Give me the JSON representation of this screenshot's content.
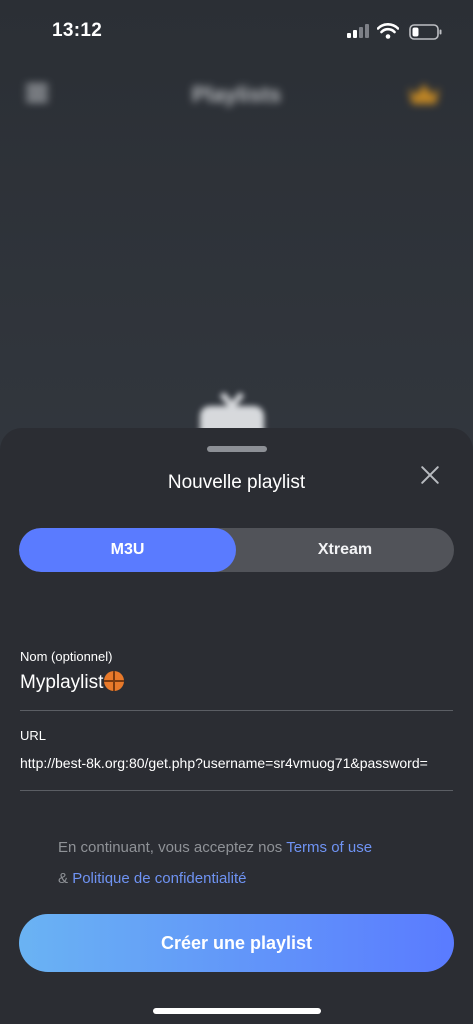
{
  "status_bar": {
    "time": "13:12"
  },
  "background": {
    "title": "Playlists"
  },
  "sheet": {
    "title": "Nouvelle playlist",
    "tabs": [
      {
        "label": "M3U",
        "selected": true
      },
      {
        "label": "Xtream",
        "selected": false
      }
    ],
    "name_field": {
      "label": "Nom (optionnel)",
      "value": "Myplaylist"
    },
    "url_field": {
      "label": "URL",
      "value": "http://best-8k.org:80/get.php?username=sr4vmuog71&password="
    },
    "legal": {
      "prefix": "En continuant, vous acceptez nos",
      "terms_link": "Terms of use",
      "amp": "&",
      "privacy_link": "Politique de confidentialité"
    },
    "cta_label": "Créer une playlist"
  },
  "colors": {
    "accent": "#5a7bff",
    "link": "#6f93f3",
    "sheet_bg": "#2b2d33"
  },
  "icons": [
    "signal-icon",
    "wifi-icon",
    "battery-icon",
    "menu-icon",
    "crown-icon",
    "tv-icon",
    "close-icon",
    "basketball-emoji"
  ]
}
